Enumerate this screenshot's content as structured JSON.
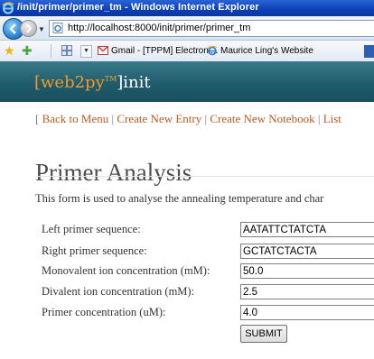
{
  "window": {
    "title": "/init/primer/primer_tm - Windows Internet Explorer"
  },
  "address_bar": {
    "url": "http://localhost:8000/init/primer/primer_tm"
  },
  "favorites_bar": {
    "links": [
      {
        "label": "Gmail - [TPPM] Electroni...",
        "icon": "gmail-icon"
      },
      {
        "label": "Maurice Ling's Website",
        "icon": "ie-page-icon"
      }
    ]
  },
  "site_header": {
    "brand_part1": "[web2py",
    "brand_tm": "TM",
    "brand_part2": "]init"
  },
  "menu": {
    "open_bracket": "[",
    "items": [
      "Back to Menu",
      "Create New Entry",
      "Create New Notebook",
      "List"
    ],
    "separator": " | "
  },
  "page": {
    "title": "Primer Analysis",
    "intro": "This form is used to analyse the annealing temperature and char"
  },
  "form": {
    "fields": [
      {
        "label": "Left primer sequence:",
        "value": "AATATTCTATCTA"
      },
      {
        "label": "Right primer sequence:",
        "value": "GCTATCTACTA"
      },
      {
        "label": "Monovalent ion concentration (mM):",
        "value": "50.0"
      },
      {
        "label": "Divalent ion concentration (mM):",
        "value": "2.5"
      },
      {
        "label": "Primer concentration (uM):",
        "value": "4.0"
      }
    ],
    "submit_label": "SUBMIT"
  },
  "colors": {
    "titlebar": "#0b3fb4",
    "header_bg": "#1f5c6c",
    "brand_orange": "#f59a2a",
    "link_orange": "#c0591e"
  }
}
